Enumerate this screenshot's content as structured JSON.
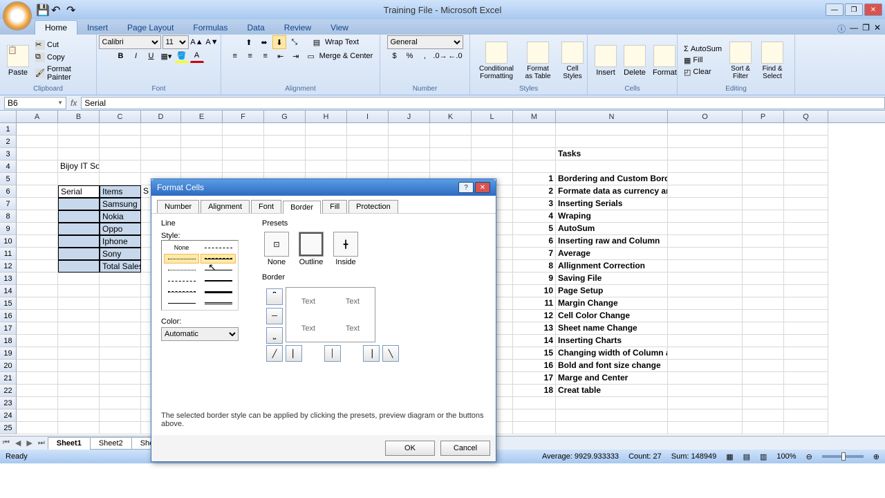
{
  "app_title": "Training File - Microsoft Excel",
  "ribbon_tabs": [
    "Home",
    "Insert",
    "Page Layout",
    "Formulas",
    "Data",
    "Review",
    "View"
  ],
  "active_ribbon_tab": "Home",
  "clipboard": {
    "paste": "Paste",
    "cut": "Cut",
    "copy": "Copy",
    "format_painter": "Format Painter",
    "label": "Clipboard"
  },
  "font": {
    "name": "Calibri",
    "size": "11",
    "label": "Font"
  },
  "alignment": {
    "wrap": "Wrap Text",
    "merge": "Merge & Center",
    "label": "Alignment"
  },
  "number": {
    "format": "General",
    "label": "Number"
  },
  "styles": {
    "cond": "Conditional Formatting",
    "fat": "Format as Table",
    "cell": "Cell Styles",
    "label": "Styles"
  },
  "cells": {
    "insert": "Insert",
    "delete": "Delete",
    "format": "Format",
    "label": "Cells"
  },
  "editing": {
    "autosum": "AutoSum",
    "fill": "Fill",
    "clear": "Clear",
    "sort": "Sort & Filter",
    "find": "Find & Select",
    "label": "Editing"
  },
  "name_box": "B6",
  "formula_value": "Serial",
  "columns": [
    "A",
    "B",
    "C",
    "D",
    "E",
    "F",
    "G",
    "H",
    "I",
    "J",
    "K",
    "L",
    "M",
    "N",
    "O",
    "P",
    "Q"
  ],
  "sheet_data": {
    "B4": "Bijoy IT Solution",
    "B6": "Serial",
    "C6": "Items",
    "D6": "S",
    "C7": "Samsung",
    "C8": "Nokia",
    "C9": "Oppo",
    "C10": "Iphone",
    "C11": "Sony",
    "C12": "Total Sales b",
    "N3": "Tasks",
    "tasks": [
      {
        "n": "1",
        "t": "Bordering and Custom Bordering",
        "bold": true
      },
      {
        "n": "2",
        "t": "Formate data as currency and accouting view",
        "bold": true
      },
      {
        "n": "3",
        "t": "Inserting Serials",
        "bold": true
      },
      {
        "n": "4",
        "t": "Wraping",
        "bold": true
      },
      {
        "n": "5",
        "t": "AutoSum",
        "bold": true
      },
      {
        "n": "6",
        "t": "Inserting raw and Column",
        "bold": true
      },
      {
        "n": "7",
        "t": "Average",
        "bold": true
      },
      {
        "n": "8",
        "t": "Allignment Correction",
        "bold": true
      },
      {
        "n": "9",
        "t": "Saving File",
        "bold": true
      },
      {
        "n": "10",
        "t": "Page Setup",
        "bold": true
      },
      {
        "n": "11",
        "t": "Margin Change",
        "bold": true
      },
      {
        "n": "12",
        "t": "Cell Color Change",
        "bold": true
      },
      {
        "n": "13",
        "t": "Sheet name Change",
        "bold": true
      },
      {
        "n": "14",
        "t": "Inserting Charts",
        "bold": true
      },
      {
        "n": "15",
        "t": "Changing width of Column and fit within",
        "bold": true
      },
      {
        "n": "16",
        "t": "Bold and font size change",
        "bold": true
      },
      {
        "n": "17",
        "t": "Marge and Center",
        "bold": true
      },
      {
        "n": "18",
        "t": "Creat table",
        "bold": true
      }
    ]
  },
  "sheets": [
    "Sheet1",
    "Sheet2",
    "Sheet3"
  ],
  "status": {
    "ready": "Ready",
    "avg": "Average: 9929.933333",
    "count": "Count: 27",
    "sum": "Sum: 148949",
    "zoom": "100%"
  },
  "dialog": {
    "title": "Format Cells",
    "tabs": [
      "Number",
      "Alignment",
      "Font",
      "Border",
      "Fill",
      "Protection"
    ],
    "active_tab": "Border",
    "line_label": "Line",
    "style_label": "Style:",
    "style_none": "None",
    "color_label": "Color:",
    "color_value": "Automatic",
    "presets_label": "Presets",
    "preset_none": "None",
    "preset_outline": "Outline",
    "preset_inside": "Inside",
    "border_label": "Border",
    "preview_text": "Text",
    "hint": "The selected border style can be applied by clicking the presets, preview diagram or the buttons above.",
    "ok": "OK",
    "cancel": "Cancel"
  }
}
